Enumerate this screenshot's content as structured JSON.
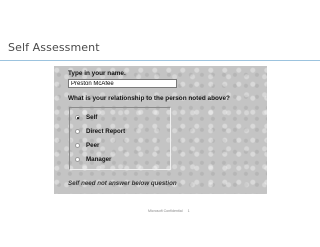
{
  "slide": {
    "title": "Self Assessment",
    "footer_text": "Microsoft Confidential",
    "page_number": "1"
  },
  "form": {
    "name_question": "Type in your name.",
    "name_value": "Preston McAfee",
    "relationship_question": "What is your relationship to the person noted above?",
    "options": [
      {
        "label": "Self",
        "selected": true
      },
      {
        "label": "Direct Report",
        "selected": false
      },
      {
        "label": "Peer",
        "selected": false
      },
      {
        "label": "Manager",
        "selected": false
      }
    ],
    "note": "Self need not answer below question"
  },
  "colors": {
    "panel_bg": "#c4c4c4",
    "title_rule": "#9cc3de"
  }
}
